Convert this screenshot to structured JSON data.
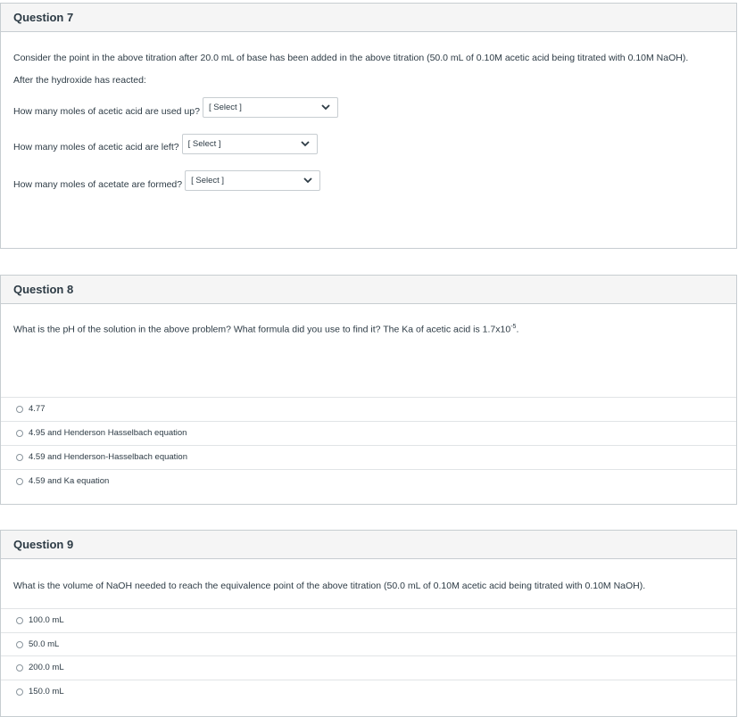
{
  "q7": {
    "title": "Question 7",
    "intro": "Consider the point in the above titration after 20.0 mL of base has been added in the above titration (50.0 mL of 0.10M acetic acid being titrated with 0.10M NaOH).",
    "after": "After the hydroxide has reacted:",
    "rows": [
      {
        "label": "How many moles of acetic acid are used up?",
        "value": "[ Select ]"
      },
      {
        "label": "How many moles of acetic acid are left?",
        "value": "[ Select ]"
      },
      {
        "label": "How many moles of acetate are formed?",
        "value": "[ Select ]"
      }
    ]
  },
  "q8": {
    "title": "Question 8",
    "prompt": "What is the pH of the solution in the above problem?   What formula did you use to find it?  The Ka of acetic acid is 1.7x10",
    "prompt_exp": "-5",
    "prompt_end": ".",
    "answers": [
      "4.77",
      "4.95 and Henderson Hasselbach equation",
      "4.59 and Henderson-Hasselbach equation",
      "4.59 and Ka equation"
    ]
  },
  "q9": {
    "title": "Question 9",
    "prompt": "What is the volume of NaOH needed to reach the equivalence point of the above titration (50.0 mL of 0.10M acetic acid being titrated with 0.10M NaOH).",
    "answers": [
      "100.0 mL",
      "50.0 mL",
      "200.0 mL",
      "150.0 mL"
    ]
  }
}
